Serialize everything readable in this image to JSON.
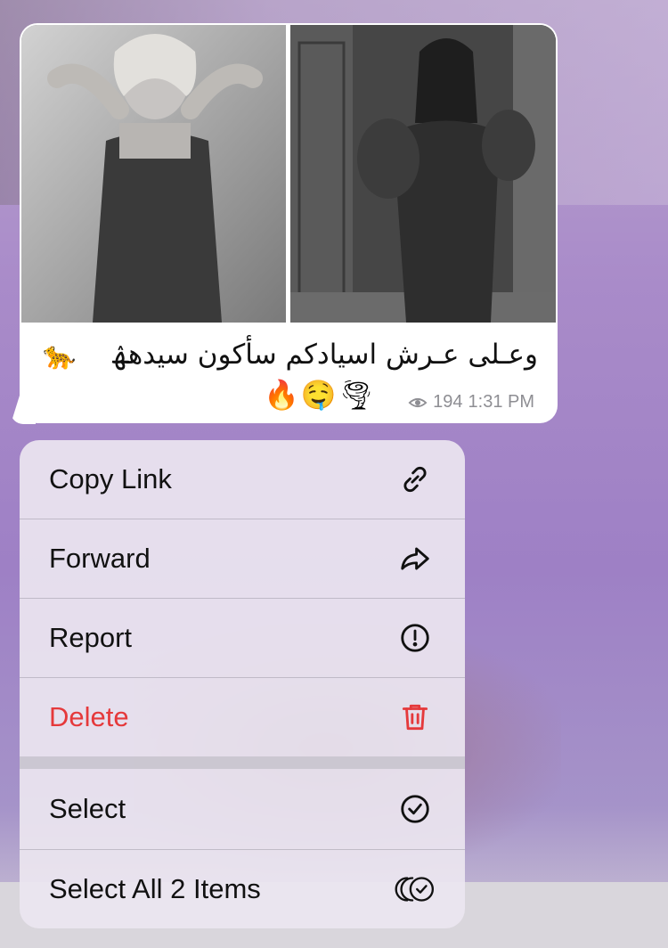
{
  "message": {
    "caption": "وعـلى عـرش اسيادكم سأكون سيدهۿ",
    "caption_emoji": "🐆",
    "reactions": "🔥🤤🌪",
    "views": "194",
    "time": "1:31 PM",
    "icons": {
      "views": "eye-icon"
    }
  },
  "menu": {
    "items": [
      {
        "label": "Copy Link",
        "icon": "link-icon"
      },
      {
        "label": "Forward",
        "icon": "forward-arrow-icon"
      },
      {
        "label": "Report",
        "icon": "exclamation-circle-icon"
      },
      {
        "label": "Delete",
        "icon": "trash-icon",
        "color": "#e5393b"
      },
      {
        "label": "Select",
        "icon": "check-circle-icon"
      },
      {
        "label": "Select All 2 Items",
        "icon": "multi-check-circle-icon"
      }
    ]
  },
  "colors": {
    "accent_danger": "#e5393b",
    "text": "#111111",
    "meta": "#8e8e93"
  }
}
